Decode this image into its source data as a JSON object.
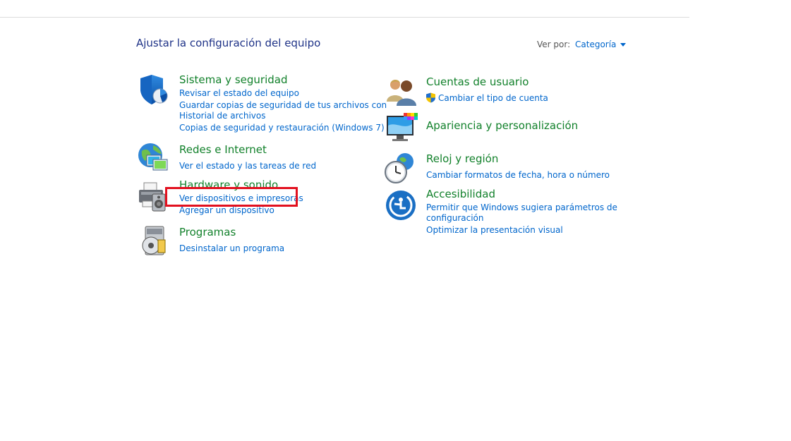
{
  "page": {
    "title": "Ajustar la configuración del equipo",
    "view_by_label": "Ver por:",
    "view_by_value": "Categoría"
  },
  "colors": {
    "category_title": "#12812b",
    "link": "#0066cc",
    "page_title": "#1e3287",
    "highlight": "#e2101e"
  },
  "left_categories": [
    {
      "icon": "shield-icon",
      "title": "Sistema y seguridad",
      "links": [
        "Revisar el estado del equipo",
        "Guardar copias de seguridad de tus archivos con",
        "Historial de archivos",
        "Copias de seguridad y restauración (Windows 7)"
      ]
    },
    {
      "icon": "network-globe-icon",
      "title": "Redes e Internet",
      "links": [
        "Ver el estado y las tareas de red"
      ]
    },
    {
      "icon": "printer-speaker-icon",
      "title": "Hardware y sonido",
      "links": [
        "Ver dispositivos e impresoras",
        "Agregar un dispositivo"
      ]
    },
    {
      "icon": "programs-disc-icon",
      "title": "Programas",
      "links": [
        "Desinstalar un programa"
      ]
    }
  ],
  "right_categories": [
    {
      "icon": "users-icon",
      "title": "Cuentas de usuario",
      "links": [
        "Cambiar el tipo de cuenta"
      ]
    },
    {
      "icon": "monitor-palette-icon",
      "title": "Apariencia y personalización",
      "links": []
    },
    {
      "icon": "clock-globe-icon",
      "title": "Reloj y región",
      "links": [
        "Cambiar formatos de fecha, hora o número"
      ]
    },
    {
      "icon": "accessibility-icon",
      "title": "Accesibilidad",
      "links": [
        "Permitir que Windows sugiera parámetros de",
        "configuración",
        "Optimizar la presentación visual"
      ]
    }
  ]
}
